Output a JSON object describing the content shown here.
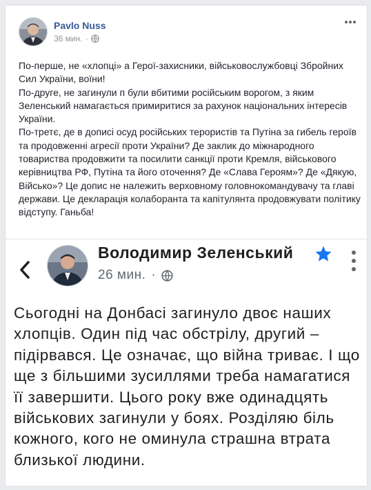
{
  "post": {
    "author": "Pavlo Nuss",
    "time": "36 мин.",
    "separator": "·",
    "paragraphs": [
      "По-перше, не «хлопці» а Герої-захисники, військовослужбовці Збройних Сил України, воїни!",
      "По-друге, не загинули п були вбитими російським ворогом, з яким Зеленський намагається примиритися за рахунок національних інтересів України.",
      "По-третє, де в дописі осуд російських терористів та Путіна за гибель героїв та продовженні агресії проти України? Де заклик до міжнародного товариства продовжити та посилити санкції проти Кремля, військового керівництва РФ, Путіна та його оточення? Де «Слава Героям»? Де «Дякую, Військо»? Це допис не належить верховному головнокомандувачу та главі держави. Це декларація колаборанта та капітулянта продовжувати політику відступу. Ганьба!"
    ],
    "more_icon": "horizontal-dots-icon",
    "privacy_icon": "globe-icon"
  },
  "shared": {
    "author": "Володимир Зеленський",
    "time": "26 мин.",
    "separator": "·",
    "text": "Сьогодні на Донбасі загинуло двоє наших хлопців. Один під час обстрілу, другий – підірвався. Це означає, що війна триває. І що ще з більшими зусиллями треба намагатися її завершити. Цього року вже одинадцять військових загинули у боях. Розділяю біль кожного, кого не оминула страшна втрата близької людини.",
    "verified_icon": "verified-star-icon",
    "back_icon": "back-chevron-icon",
    "more_icon": "vertical-dots-icon",
    "colors": {
      "verified": "#1877f2",
      "link": "#385898"
    }
  }
}
